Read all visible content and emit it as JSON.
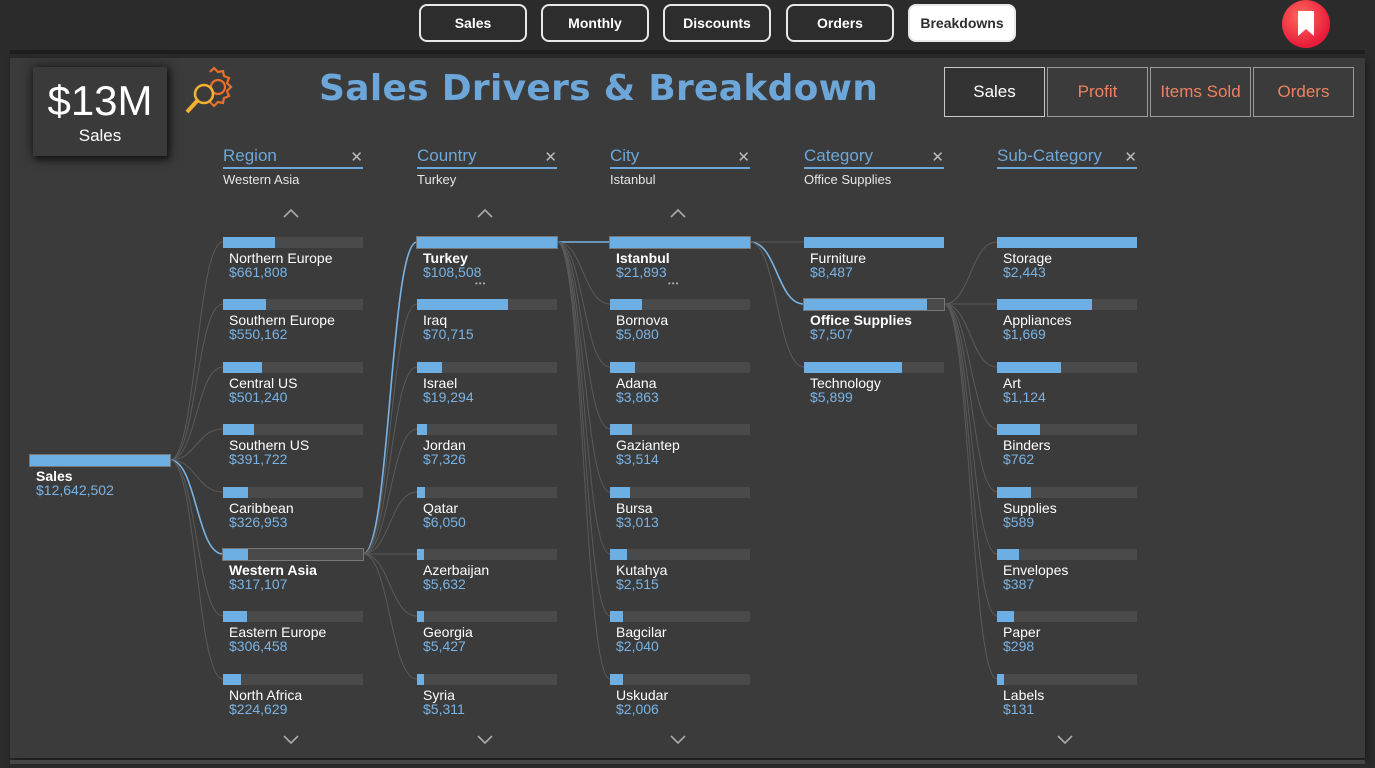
{
  "nav": {
    "tabs": [
      {
        "label": "Sales",
        "active": false
      },
      {
        "label": "Monthly",
        "active": false
      },
      {
        "label": "Discounts",
        "active": false
      },
      {
        "label": "Orders",
        "active": false
      },
      {
        "label": "Breakdowns",
        "active": true
      }
    ],
    "bookmark_icon": "bookmark-icon"
  },
  "kpi": {
    "value": "$13M",
    "label": "Sales"
  },
  "title": "Sales Drivers & Breakdown",
  "metrics": [
    {
      "label": "Sales",
      "active": true
    },
    {
      "label": "Profit",
      "active": false
    },
    {
      "label": "Items Sold",
      "active": false
    },
    {
      "label": "Orders",
      "active": false
    }
  ],
  "colors": {
    "accent": "#6da7d9",
    "bar": "#6daee3",
    "metric_inactive": "#f08060",
    "bookmark": "#e81b3a"
  },
  "tree": {
    "root": {
      "label": "Sales",
      "value": "$12,642,502"
    },
    "levels": [
      {
        "name": "Region",
        "filter": "Western Asia",
        "selected": 5,
        "items": [
          {
            "label": "Northern Europe",
            "value": "$661,808",
            "pct": 0.37
          },
          {
            "label": "Southern Europe",
            "value": "$550,162",
            "pct": 0.31
          },
          {
            "label": "Central US",
            "value": "$501,240",
            "pct": 0.28
          },
          {
            "label": "Southern US",
            "value": "$391,722",
            "pct": 0.22
          },
          {
            "label": "Caribbean",
            "value": "$326,953",
            "pct": 0.18
          },
          {
            "label": "Western Asia",
            "value": "$317,107",
            "pct": 0.18
          },
          {
            "label": "Eastern Europe",
            "value": "$306,458",
            "pct": 0.17
          },
          {
            "label": "North Africa",
            "value": "$224,629",
            "pct": 0.13
          }
        ]
      },
      {
        "name": "Country",
        "filter": "Turkey",
        "selected": 0,
        "items": [
          {
            "label": "Turkey",
            "value": "$108,508",
            "pct": 1.0
          },
          {
            "label": "Iraq",
            "value": "$70,715",
            "pct": 0.65
          },
          {
            "label": "Israel",
            "value": "$19,294",
            "pct": 0.18
          },
          {
            "label": "Jordan",
            "value": "$7,326",
            "pct": 0.07
          },
          {
            "label": "Qatar",
            "value": "$6,050",
            "pct": 0.06
          },
          {
            "label": "Azerbaijan",
            "value": "$5,632",
            "pct": 0.05
          },
          {
            "label": "Georgia",
            "value": "$5,427",
            "pct": 0.05
          },
          {
            "label": "Syria",
            "value": "$5,311",
            "pct": 0.05
          }
        ]
      },
      {
        "name": "City",
        "filter": "Istanbul",
        "selected": 0,
        "items": [
          {
            "label": "Istanbul",
            "value": "$21,893",
            "pct": 1.0
          },
          {
            "label": "Bornova",
            "value": "$5,080",
            "pct": 0.23
          },
          {
            "label": "Adana",
            "value": "$3,863",
            "pct": 0.18
          },
          {
            "label": "Gaziantep",
            "value": "$3,514",
            "pct": 0.16
          },
          {
            "label": "Bursa",
            "value": "$3,013",
            "pct": 0.14
          },
          {
            "label": "Kutahya",
            "value": "$2,515",
            "pct": 0.12
          },
          {
            "label": "Bagcilar",
            "value": "$2,040",
            "pct": 0.09
          },
          {
            "label": "Uskudar",
            "value": "$2,006",
            "pct": 0.09
          }
        ]
      },
      {
        "name": "Category",
        "filter": "Office Supplies",
        "selected": 1,
        "items": [
          {
            "label": "Furniture",
            "value": "$8,487",
            "pct": 1.0
          },
          {
            "label": "Office Supplies",
            "value": "$7,507",
            "pct": 0.88
          },
          {
            "label": "Technology",
            "value": "$5,899",
            "pct": 0.7
          }
        ]
      },
      {
        "name": "Sub-Category",
        "filter": "",
        "selected": -1,
        "items": [
          {
            "label": "Storage",
            "value": "$2,443",
            "pct": 1.0
          },
          {
            "label": "Appliances",
            "value": "$1,669",
            "pct": 0.68
          },
          {
            "label": "Art",
            "value": "$1,124",
            "pct": 0.46
          },
          {
            "label": "Binders",
            "value": "$762",
            "pct": 0.31
          },
          {
            "label": "Supplies",
            "value": "$589",
            "pct": 0.24
          },
          {
            "label": "Envelopes",
            "value": "$387",
            "pct": 0.16
          },
          {
            "label": "Paper",
            "value": "$298",
            "pct": 0.12
          },
          {
            "label": "Labels",
            "value": "$131",
            "pct": 0.05
          }
        ]
      }
    ]
  }
}
